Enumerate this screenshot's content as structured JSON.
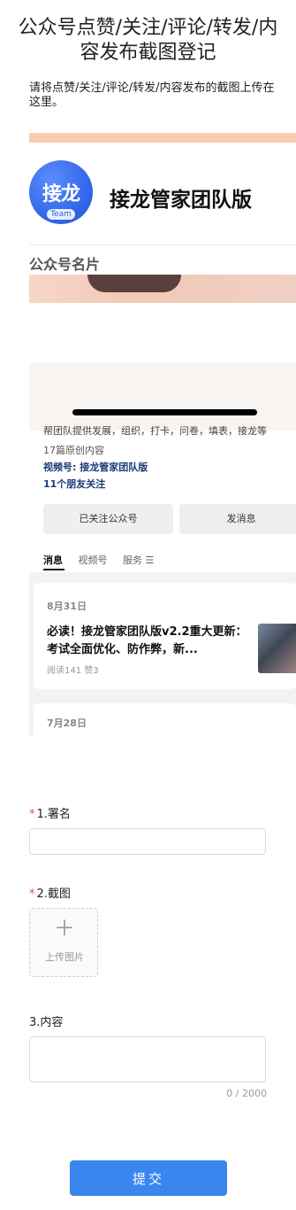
{
  "page": {
    "title": "公众号点赞/关注/评论/转发/内容发布截图登记",
    "description": "请将点赞/关注/评论/转发/内容发布的截图上传在这里。"
  },
  "screenshot": {
    "logo_text": "接龙",
    "logo_badge": "Team",
    "brand_name": "接龙管家团队版",
    "card_label": "公众号名片",
    "cut_text": "帮团队提供发展，组织，打卡，问卷，填表，接龙等",
    "original_count": "17篇原创内容",
    "video_account": "视频号: 接龙管家团队版",
    "friends_following": "11个朋友关注",
    "follow_button": "已关注公众号",
    "message_button": "发消息",
    "tabs": [
      "消息",
      "视频号",
      "服务 ☰"
    ],
    "posts": [
      {
        "date": "8月31日",
        "title": "必读！接龙管家团队版v2.2重大更新：考试全面优化、防作弊，新...",
        "meta": "阅读141  赞3"
      },
      {
        "date": "7月28日"
      }
    ]
  },
  "form": {
    "fields": [
      {
        "number": "1.",
        "label": "署名",
        "required": true,
        "value": "",
        "placeholder": ""
      },
      {
        "number": "2.",
        "label": "截图",
        "required": true,
        "upload_icon": "plus-icon",
        "upload_text": "上传图片"
      },
      {
        "number": "3.",
        "label": "内容",
        "required": false,
        "value": "",
        "placeholder": "",
        "counter": "0 / 2000"
      }
    ],
    "required_mark": "*",
    "submit_label": "提交"
  },
  "colors": {
    "primary": "#3a86ef",
    "required": "#e34d4d",
    "brand_blue": "#2f63e6",
    "peach": "#f8cdb2"
  }
}
